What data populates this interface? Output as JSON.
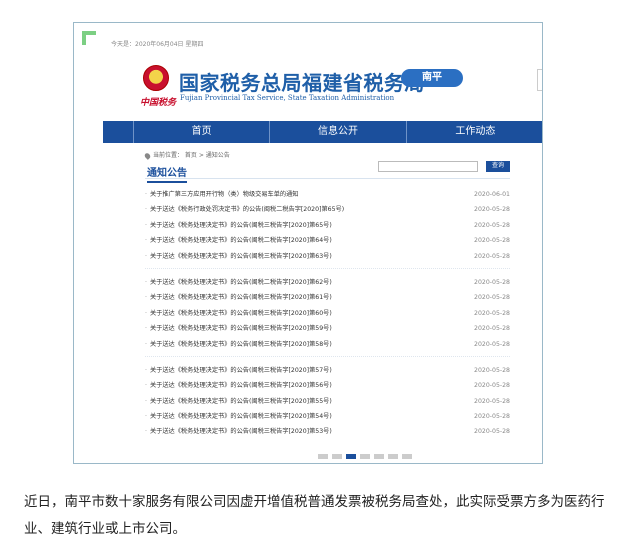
{
  "site": {
    "topbar_text": "今天是：2020年06月04日 星期四",
    "title_cn": "国家税务总局福建省税务局",
    "title_en": "Fujian Provincial Tax Service, State Taxation Administration",
    "brand_logo": "中国税务",
    "region_badge": "南平",
    "nav": {
      "home": "首页",
      "info": "信息公开",
      "work": "工作动态"
    },
    "breadcrumb": "当前位置：  首页  >  通知公告",
    "section_title": "通知公告",
    "search": {
      "placeholder": "",
      "button": "查询"
    }
  },
  "notices": [
    [
      {
        "title": "关于推广第三方应用开行物（类）物级交易车单的通知",
        "date": "2020-06-01"
      },
      {
        "title": "关于送达《税务行政处罚决定书》的公告(闽税二税告字[2020]第65号)",
        "date": "2020-05-28"
      },
      {
        "title": "关于送达《税务处理决定书》的公告(闽税三税告字[2020]第65号)",
        "date": "2020-05-28"
      },
      {
        "title": "关于送达《税务处理决定书》的公告(闽税二税告字[2020]第64号)",
        "date": "2020-05-28"
      },
      {
        "title": "关于送达《税务处理决定书》的公告(闽税三税告字[2020]第63号)",
        "date": "2020-05-28"
      }
    ],
    [
      {
        "title": "关于送达《税务处理决定书》的公告(闽税二税告字[2020]第62号)",
        "date": "2020-05-28"
      },
      {
        "title": "关于送达《税务处理决定书》的公告(闽税三税告字[2020]第61号)",
        "date": "2020-05-28"
      },
      {
        "title": "关于送达《税务处理决定书》的公告(闽税三税告字[2020]第60号)",
        "date": "2020-05-28"
      },
      {
        "title": "关于送达《税务处理决定书》的公告(闽税三税告字[2020]第59号)",
        "date": "2020-05-28"
      },
      {
        "title": "关于送达《税务处理决定书》的公告(闽税三税告字[2020]第58号)",
        "date": "2020-05-28"
      }
    ],
    [
      {
        "title": "关于送达《税务处理决定书》的公告(闽税三税告字[2020]第57号)",
        "date": "2020-05-28"
      },
      {
        "title": "关于送达《税务处理决定书》的公告(闽税三税告字[2020]第56号)",
        "date": "2020-05-28"
      },
      {
        "title": "关于送达《税务处理决定书》的公告(闽税三税告字[2020]第55号)",
        "date": "2020-05-28"
      },
      {
        "title": "关于送达《税务处理决定书》的公告(闽税三税告字[2020]第54号)",
        "date": "2020-05-28"
      },
      {
        "title": "关于送达《税务处理决定书》的公告(闽税三税告字[2020]第53号)",
        "date": "2020-05-28"
      }
    ]
  ],
  "caption": "近日，南平市数十家服务有限公司因虚开增值税普通发票被税务局查处，此实际受票方多为医药行业、建筑行业或上市公司。",
  "colors": {
    "nav": "#1b4f9c",
    "title": "#1f5fa8",
    "accent_green": "#7ccf83",
    "badge": "#2b6fc2"
  }
}
